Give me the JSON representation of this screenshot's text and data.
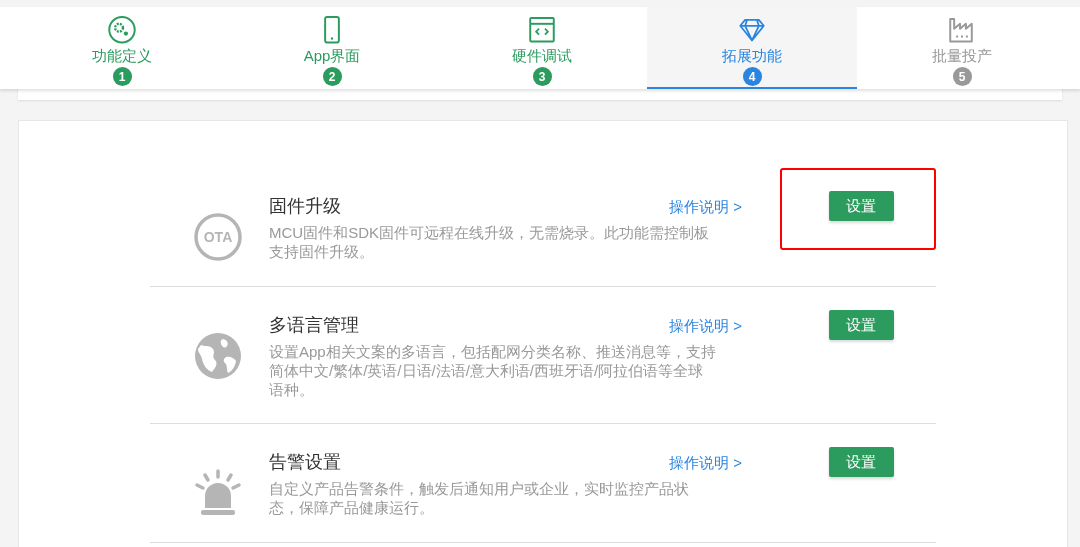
{
  "steps": [
    {
      "label": "功能定义",
      "number": "1",
      "completed": true,
      "selected": false
    },
    {
      "label": "App界面",
      "number": "2",
      "completed": true,
      "selected": false
    },
    {
      "label": "硬件调试",
      "number": "3",
      "completed": true,
      "selected": false
    },
    {
      "label": "拓展功能",
      "number": "4",
      "completed": false,
      "selected": true
    },
    {
      "label": "批量投产",
      "number": "5",
      "completed": false,
      "selected": false
    }
  ],
  "features": [
    {
      "icon_text": "OTA",
      "title": "固件升级",
      "description": "MCU固件和SDK固件可远程在线升级，无需烧录。此功能需控制板支持固件升级。",
      "link": "操作说明 >",
      "button": "设置",
      "highlighted": true
    },
    {
      "title": "多语言管理",
      "description": "设置App相关文案的多语言，包括配网分类名称、推送消息等，支持简体中文/繁体/英语/日语/法语/意大利语/西班牙语/阿拉伯语等全球语种。",
      "link": "操作说明 >",
      "button": "设置",
      "highlighted": false
    },
    {
      "title": "告警设置",
      "description": "自定义产品告警条件，触发后通知用户或企业，实时监控产品状态，保障产品健康运行。",
      "link": "操作说明 >",
      "button": "设置",
      "highlighted": false
    }
  ]
}
